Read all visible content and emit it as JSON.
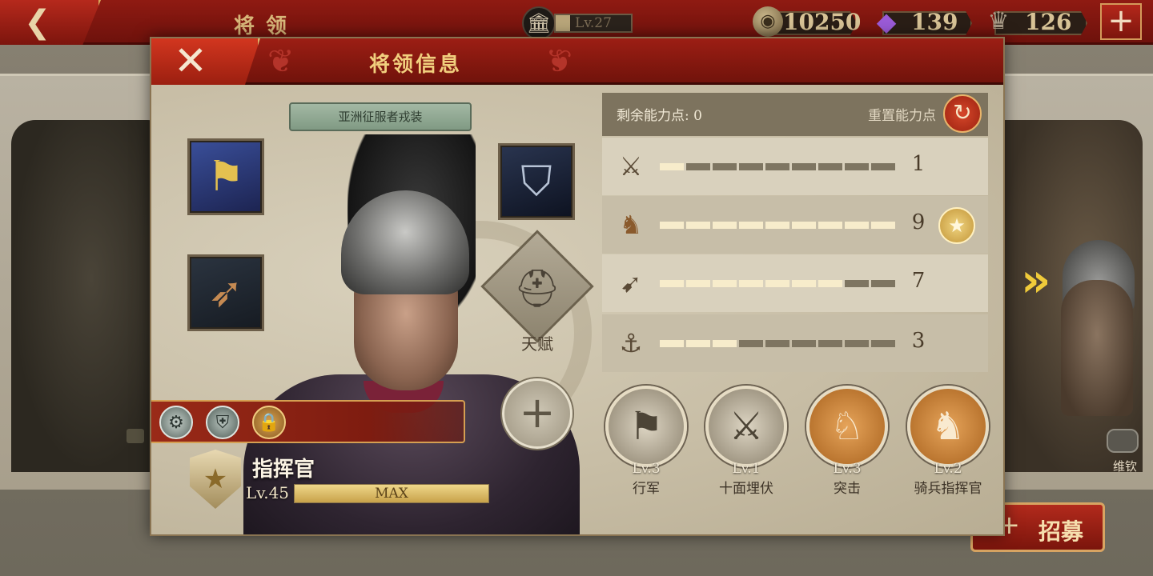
{
  "topbar": {
    "back_icon": "back-arrow-icon",
    "title": "将领",
    "player_level": "Lv.27",
    "player_level_progress": 0.19,
    "resources": {
      "coins": "10250",
      "gems": "139",
      "crowns": "126"
    },
    "add_icon": "plus-icon"
  },
  "background": {
    "right_general_name": "维钦",
    "recruit_label": "招募"
  },
  "modal": {
    "title": "将领信息",
    "close_icon": "close-icon",
    "outfit_name": "亚洲征服者戎装",
    "equipment": [
      {
        "slot": "banner",
        "icon": "banner-icon"
      },
      {
        "slot": "crossbow",
        "icon": "crossbow-icon"
      },
      {
        "slot": "shield",
        "icon": "shield-icon"
      }
    ],
    "talent_label": "天赋",
    "general": {
      "name": "指挥官",
      "level": "Lv.45",
      "exp_label": "MAX",
      "exp_progress": 1.0
    },
    "badges": [
      {
        "icon": "military-badge-icon",
        "locked": false
      },
      {
        "icon": "shield-badge-icon",
        "locked": false
      },
      {
        "icon": "lock-icon",
        "locked": true
      }
    ],
    "stats": {
      "remaining_points_label": "剩余能力点:",
      "remaining_points": "0",
      "reset_label": "重置能力点",
      "max_segments": 9,
      "rows": [
        {
          "icon": "sword-icon",
          "value": "1",
          "filled": 1,
          "specialty": false
        },
        {
          "icon": "horse-icon",
          "value": "9",
          "filled": 9,
          "specialty": true
        },
        {
          "icon": "bow-icon",
          "value": "7",
          "filled": 7,
          "specialty": false
        },
        {
          "icon": "anchor-icon",
          "value": "3",
          "filled": 3,
          "specialty": false
        }
      ]
    },
    "skills": [
      {
        "level": "Lv.3",
        "name": "行军",
        "style": "gray",
        "icon": "march-icon"
      },
      {
        "level": "Lv.1",
        "name": "十面埋伏",
        "style": "gray",
        "icon": "ambush-icon"
      },
      {
        "level": "Lv.3",
        "name": "突击",
        "style": "gold",
        "icon": "charge-icon"
      },
      {
        "level": "Lv.2",
        "name": "骑兵指挥官",
        "style": "gold",
        "icon": "cavalry-commander-icon"
      }
    ]
  }
}
